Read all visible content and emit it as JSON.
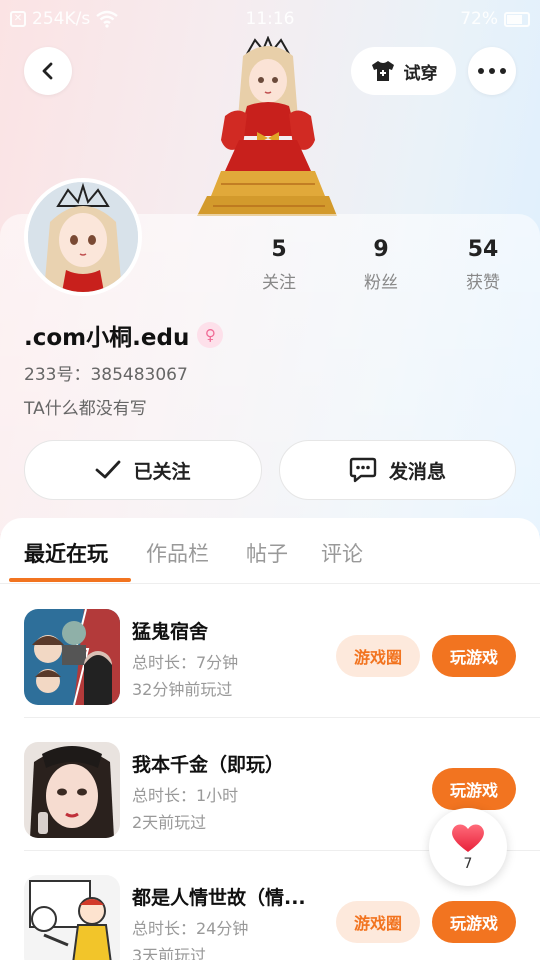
{
  "status_bar": {
    "speed": "254K/s",
    "time": "11:16",
    "battery": "72%"
  },
  "header": {
    "try_on_label": "试穿",
    "icons": [
      "back-arrow-icon",
      "shirt-icon",
      "more-dots-icon"
    ]
  },
  "profile": {
    "stats": [
      {
        "value": "5",
        "label": "关注"
      },
      {
        "value": "9",
        "label": "粉丝"
      },
      {
        "value": "54",
        "label": "获赞"
      }
    ],
    "username": ".com小桐.edu",
    "gender_icon": "female-icon",
    "uid": "233号：385483067",
    "bio": "TA什么都没有写",
    "follow_label": "已关注",
    "message_label": "发消息"
  },
  "tabs": [
    {
      "label": "最近在玩",
      "active": true
    },
    {
      "label": "作品栏",
      "active": false
    },
    {
      "label": "帖子",
      "active": false
    },
    {
      "label": "评论",
      "active": false
    }
  ],
  "games": [
    {
      "title": "猛鬼宿舍",
      "duration": "总时长：7分钟",
      "last_played": "32分钟前玩过",
      "circle_label": "游戏圈",
      "play_label": "玩游戏",
      "has_circle": true
    },
    {
      "title": "我本千金（即玩）",
      "duration": "总时长：1小时",
      "last_played": "2天前玩过",
      "circle_label": "",
      "play_label": "玩游戏",
      "has_circle": false
    },
    {
      "title": "都是人情世故（情...",
      "duration": "总时长：24分钟",
      "last_played": "3天前玩过",
      "circle_label": "游戏圈",
      "play_label": "玩游戏",
      "has_circle": true
    }
  ],
  "like_float": {
    "count": "7",
    "icon": "heart-icon"
  },
  "colors": {
    "accent": "#f27420",
    "accent_light": "#fde9dc",
    "text_primary": "#222222",
    "text_secondary": "#999999"
  }
}
